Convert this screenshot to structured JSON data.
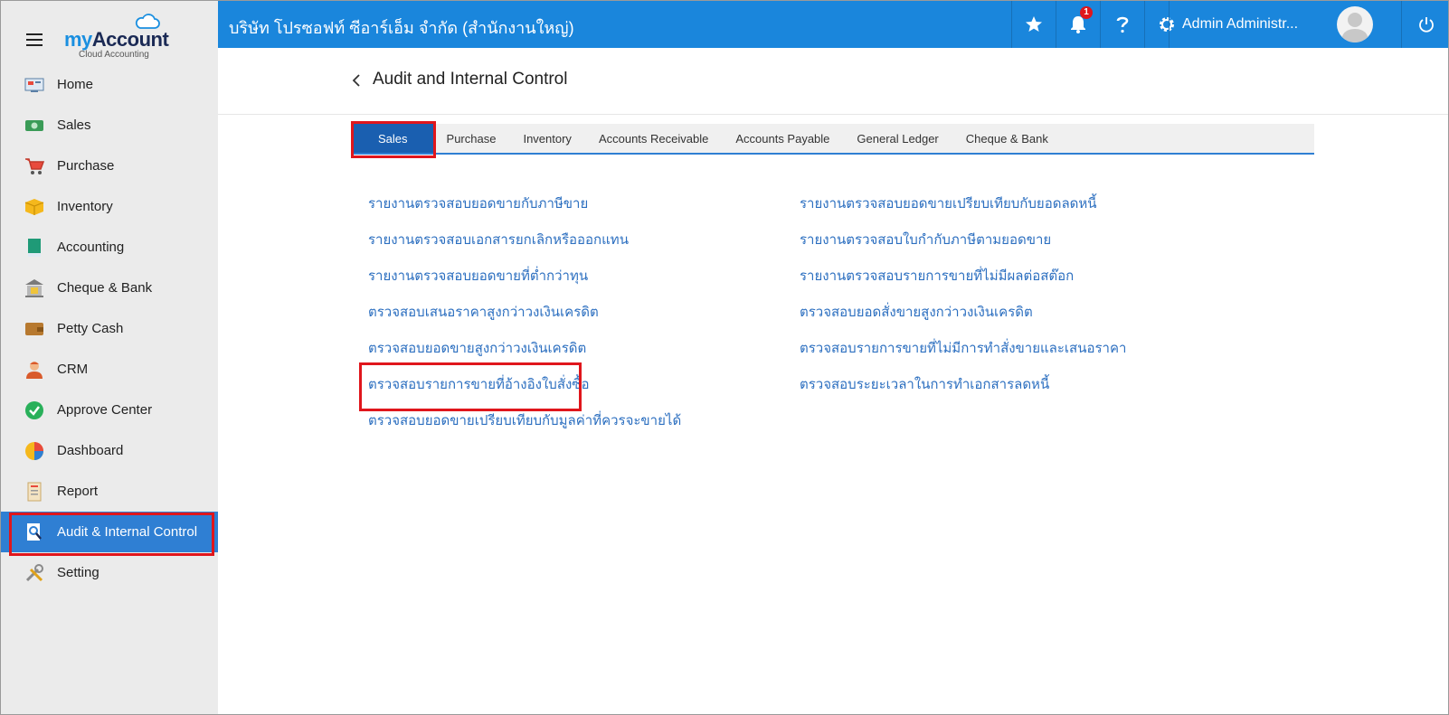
{
  "sidebar": {
    "logo": {
      "brand_a": "my",
      "brand_b": "Account",
      "subtitle": "Cloud Accounting"
    },
    "items": [
      {
        "label": "Home",
        "icon": "home-icon"
      },
      {
        "label": "Sales",
        "icon": "sales-icon"
      },
      {
        "label": "Purchase",
        "icon": "cart-icon"
      },
      {
        "label": "Inventory",
        "icon": "box-icon"
      },
      {
        "label": "Accounting",
        "icon": "book-icon"
      },
      {
        "label": "Cheque & Bank",
        "icon": "bank-icon"
      },
      {
        "label": "Petty Cash",
        "icon": "wallet-icon"
      },
      {
        "label": "CRM",
        "icon": "person-icon"
      },
      {
        "label": "Approve Center",
        "icon": "check-circle-icon"
      },
      {
        "label": "Dashboard",
        "icon": "pie-chart-icon"
      },
      {
        "label": "Report",
        "icon": "report-icon"
      },
      {
        "label": "Audit & Internal Control",
        "icon": "audit-icon",
        "active": true
      },
      {
        "label": "Setting",
        "icon": "tools-icon"
      }
    ]
  },
  "topbar": {
    "company": "บริษัท โปรซอฟท์ ซีอาร์เอ็ม จำกัด (สำนักงานใหญ่)",
    "notification_count": "1",
    "user_name": "Admin Administr..."
  },
  "page": {
    "title": "Audit and Internal Control"
  },
  "tabs": [
    {
      "label": "Sales",
      "active": true
    },
    {
      "label": "Purchase"
    },
    {
      "label": "Inventory"
    },
    {
      "label": "Accounts Receivable"
    },
    {
      "label": "Accounts Payable"
    },
    {
      "label": "General Ledger"
    },
    {
      "label": "Cheque & Bank"
    }
  ],
  "reports": {
    "left": [
      "รายงานตรวจสอบยอดขายกับภาษีขาย",
      "รายงานตรวจสอบเอกสารยกเลิกหรือออกแทน",
      "รายงานตรวจสอบยอดขายที่ต่ำกว่าทุน",
      "ตรวจสอบเสนอราคาสูงกว่าวงเงินเครดิต",
      "ตรวจสอบยอดขายสูงกว่าวงเงินเครดิต",
      "ตรวจสอบรายการขายที่อ้างอิงใบสั่งซื้อ",
      "ตรวจสอบยอดขายเปรียบเทียบกับมูลค่าที่ควรจะขายได้"
    ],
    "right": [
      "รายงานตรวจสอบยอดขายเปรียบเทียบกับยอดลดหนี้",
      "รายงานตรวจสอบใบกำกับภาษีตามยอดขาย",
      "รายงานตรวจสอบรายการขายที่ไม่มีผลต่อสต๊อก",
      "ตรวจสอบยอดสั่งขายสูงกว่าวงเงินเครดิต",
      "ตรวจสอบรายการขายที่ไม่มีการทำสั่งขายและเสนอราคา",
      "ตรวจสอบระยะเวลาในการทำเอกสารลดหนี้"
    ]
  }
}
